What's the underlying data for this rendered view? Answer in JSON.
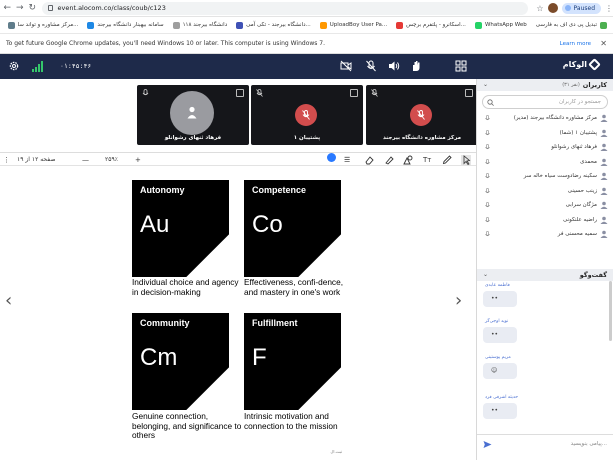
{
  "browser": {
    "url": "event.alocom.co/class/coub/c123",
    "paused_label": "Paused",
    "bookmarks": [
      "تبدیل پی دی اف به فارسی",
      "مرکز مشاوره و تواند سا...",
      "سامانه بیهبنار دانشگاه بیرجند",
      "۱۱۸ دانشگاه بیرجند",
      "دانشگاه بیرجند - تکی آمی...",
      "UploadBoy User Pa...",
      "اسکانرو - پلتفرم برچس...",
      "WhatsApp Web",
      "تبدیل پی دی اف به فلش"
    ],
    "info_message": "To get future Google Chrome updates, you'll need Windows 10 or later. This computer is using Windows 7.",
    "learn_more": "Learn more"
  },
  "app": {
    "timer": "۰۱:۴۵:۴۶",
    "logo": "الوکام"
  },
  "video_tiles": [
    {
      "name": "فرهاد ثنهای رشوانلو",
      "style": "avatar"
    },
    {
      "name": "پشتیبان ۱",
      "style": "muted"
    },
    {
      "name": "مرکز مشاوره دانشگاه بیرجند",
      "style": "muted"
    }
  ],
  "toolbar": {
    "page_info": "صفحه ۱۲ از ۱۹",
    "zoom": "۲۵۹٪",
    "pen_color": "#2979ff"
  },
  "slide": {
    "credit": "ثبت.ال",
    "cards": [
      {
        "title": "Autonomy",
        "symbol": "Au",
        "desc": "Individual choice and agency in decision-making"
      },
      {
        "title": "Competence",
        "symbol": "Co",
        "desc": "Effectiveness, confi-dence, and mastery in one's work"
      },
      {
        "title": "Community",
        "symbol": "Cm",
        "desc": "Genuine connection, belonging, and significance to others"
      },
      {
        "title": "Fulfillment",
        "symbol": "F",
        "desc": "Intrinsic motivation and connection to the mission"
      }
    ]
  },
  "sidebar": {
    "users_title": "کاربران",
    "users_count": "(۳۱ نفر)",
    "search_placeholder": "جستجو در کاربران",
    "users": [
      "مرکز مشاوره دانشگاه بیرجند (مدیر)",
      "پشتیبان ۱ (شما)",
      "فرهاد ثنهای رشوانلو",
      "محمدی",
      "سکینه رضادوست سیاه خاله سر",
      "زینب حسینی",
      "مژگان سرابی",
      "راضیه علنکونی",
      "سمیه محسنی فر"
    ],
    "chat_title": "گفت‌وگو",
    "messages": [
      {
        "sender": "فاطمه عابدی",
        "text": "••"
      },
      {
        "sender": "نوید اوجی‌گر",
        "text": "••"
      },
      {
        "sender": "مریم پوستینی",
        "text": "☺"
      },
      {
        "sender": "حدیثه اشرفی فرد",
        "text": "••"
      }
    ],
    "chat_placeholder": "پیامی بنویسید..."
  }
}
